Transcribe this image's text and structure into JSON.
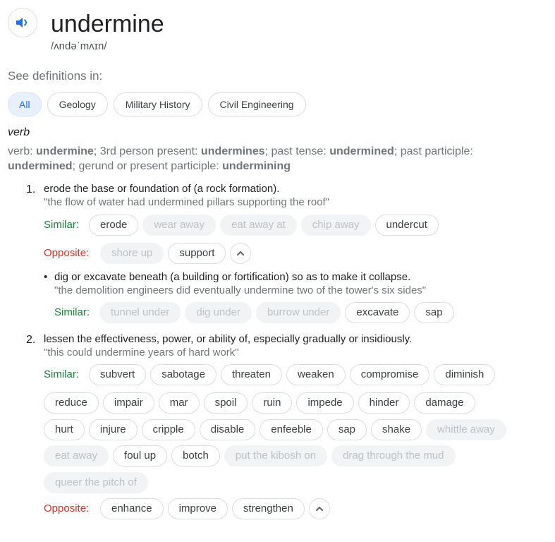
{
  "header": {
    "word": "undermine",
    "phonetic": "/ʌndəˈmʌɪn/",
    "speaker_icon": "speaker-icon"
  },
  "see_definitions_label": "See definitions in:",
  "filters": [
    "All",
    "Geology",
    "Military History",
    "Civil Engineering"
  ],
  "part_of_speech": "verb",
  "forms": {
    "verb_label": "verb:",
    "verb": "undermine",
    "p3_label": "; 3rd person present:",
    "p3": "undermines",
    "past_label": "; past tense:",
    "past": "undermined",
    "pp_label": "; past participle:",
    "pp": "undermined",
    "ger_label": "; gerund or present participle:",
    "ger": "undermining"
  },
  "labels": {
    "similar": "Similar:",
    "opposite": "Opposite:"
  },
  "senses": [
    {
      "number": "1.",
      "definition": "erode the base or foundation of (a rock formation).",
      "example": "\"the flow of water had undermined pillars supporting the roof\"",
      "similar": [
        {
          "text": "erode",
          "dim": false
        },
        {
          "text": "wear away",
          "dim": true
        },
        {
          "text": "eat away at",
          "dim": true
        },
        {
          "text": "chip away",
          "dim": true
        },
        {
          "text": "undercut",
          "dim": false
        }
      ],
      "opposite": [
        {
          "text": "shore up",
          "dim": true
        },
        {
          "text": "support",
          "dim": false
        }
      ],
      "sub": {
        "bullet": "•",
        "definition": "dig or excavate beneath (a building or fortification) so as to make it collapse.",
        "example": "\"the demolition engineers did eventually undermine two of the tower's six sides\"",
        "similar": [
          {
            "text": "tunnel under",
            "dim": true
          },
          {
            "text": "dig under",
            "dim": true
          },
          {
            "text": "burrow under",
            "dim": true
          },
          {
            "text": "excavate",
            "dim": false
          },
          {
            "text": "sap",
            "dim": false
          }
        ]
      }
    },
    {
      "number": "2.",
      "definition": "lessen the effectiveness, power, or ability of, especially gradually or insidiously.",
      "example": "\"this could undermine years of hard work\"",
      "similar_rows": [
        [
          {
            "text": "subvert",
            "dim": false
          },
          {
            "text": "sabotage",
            "dim": false
          },
          {
            "text": "threaten",
            "dim": false
          },
          {
            "text": "weaken",
            "dim": false
          },
          {
            "text": "compromise",
            "dim": false
          },
          {
            "text": "diminish",
            "dim": false
          }
        ],
        [
          {
            "text": "reduce",
            "dim": false
          },
          {
            "text": "impair",
            "dim": false
          },
          {
            "text": "mar",
            "dim": false
          },
          {
            "text": "spoil",
            "dim": false
          },
          {
            "text": "ruin",
            "dim": false
          },
          {
            "text": "impede",
            "dim": false
          },
          {
            "text": "hinder",
            "dim": false
          },
          {
            "text": "damage",
            "dim": false
          }
        ],
        [
          {
            "text": "hurt",
            "dim": false
          },
          {
            "text": "injure",
            "dim": false
          },
          {
            "text": "cripple",
            "dim": false
          },
          {
            "text": "disable",
            "dim": false
          },
          {
            "text": "enfeeble",
            "dim": false
          },
          {
            "text": "sap",
            "dim": false
          },
          {
            "text": "shake",
            "dim": false
          },
          {
            "text": "whittle away",
            "dim": true
          }
        ],
        [
          {
            "text": "eat away",
            "dim": true
          },
          {
            "text": "foul up",
            "dim": false
          },
          {
            "text": "botch",
            "dim": false
          },
          {
            "text": "put the kibosh on",
            "dim": true
          },
          {
            "text": "drag through the mud",
            "dim": true
          }
        ],
        [
          {
            "text": "queer the pitch of",
            "dim": true
          }
        ]
      ],
      "opposite": [
        {
          "text": "enhance",
          "dim": false
        },
        {
          "text": "improve",
          "dim": false
        },
        {
          "text": "strengthen",
          "dim": false
        }
      ]
    }
  ],
  "colors": {
    "similar_label": "#188038",
    "opposite_label": "#d93025",
    "active_filter": "#1a73e8",
    "dim_chip_bg": "#f1f3f4"
  }
}
